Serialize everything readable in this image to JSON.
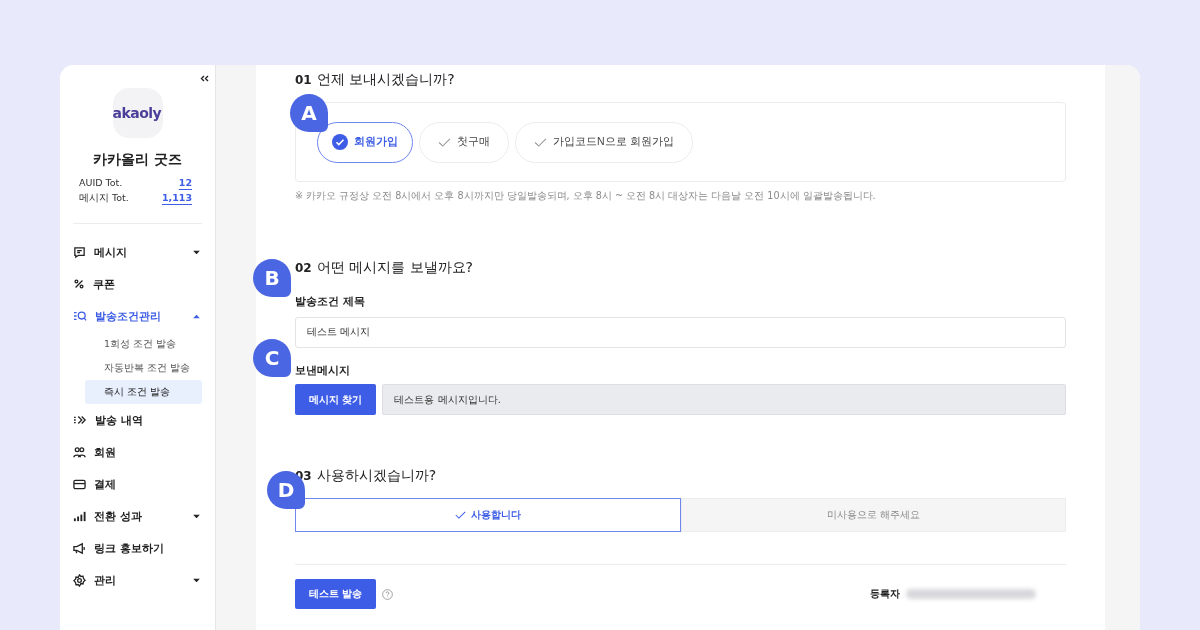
{
  "sidebar": {
    "logo_text": "akaoly",
    "shop_name": "카카올리 굿즈",
    "stats": [
      {
        "label": "AUID Tot.",
        "value": "12"
      },
      {
        "label": "메시지 Tot.",
        "value": "1,113"
      }
    ],
    "nav": [
      {
        "label": "메시지",
        "selected": false,
        "expanded": false
      },
      {
        "label": "쿠폰",
        "selected": false
      },
      {
        "label": "발송조건관리",
        "selected": true,
        "expanded": true,
        "children": [
          {
            "label": "1회성 조건 발송",
            "selected": false
          },
          {
            "label": "자동반복 조건 발송",
            "selected": false
          },
          {
            "label": "즉시 조건 발송",
            "selected": true
          }
        ]
      },
      {
        "label": "발송 내역",
        "selected": false
      },
      {
        "label": "회원",
        "selected": false
      },
      {
        "label": "결제",
        "selected": false
      },
      {
        "label": "전환 성과",
        "selected": false,
        "expanded": false
      },
      {
        "label": "링크 홍보하기",
        "selected": false
      },
      {
        "label": "관리",
        "selected": false,
        "expanded": false
      }
    ]
  },
  "form": {
    "step1": {
      "badge": "A",
      "number": "01",
      "title": "언제 보내시겠습니까?",
      "options": [
        {
          "label": "회원가입",
          "selected": true
        },
        {
          "label": "첫구매",
          "selected": false
        },
        {
          "label": "가입코드N으로 회원가입",
          "selected": false
        }
      ],
      "note": "※ 카카오 규정상 오전 8시에서 오후 8시까지만 당일발송되며, 오후 8시 ~ 오전 8시 대상자는 다음날 오전 10시에 일괄발송됩니다."
    },
    "step2": {
      "badge": "B",
      "number": "02",
      "title": "어떤 메시지를 보낼까요?",
      "title_label": "발송조건 제목",
      "title_value": "테스트 메시지",
      "message_badge": "C",
      "message_label": "보낸메시지",
      "find_button": "메시지 찾기",
      "message_value": "테스트용 메시지입니다."
    },
    "step3": {
      "badge": "D",
      "number": "03",
      "title": "사용하시겠습니까?",
      "options": [
        {
          "label": "사용합니다",
          "selected": true
        },
        {
          "label": "미사용으로 해주세요",
          "selected": false
        }
      ]
    },
    "test_button": "테스트 발송",
    "registrant_label": "등록자"
  }
}
